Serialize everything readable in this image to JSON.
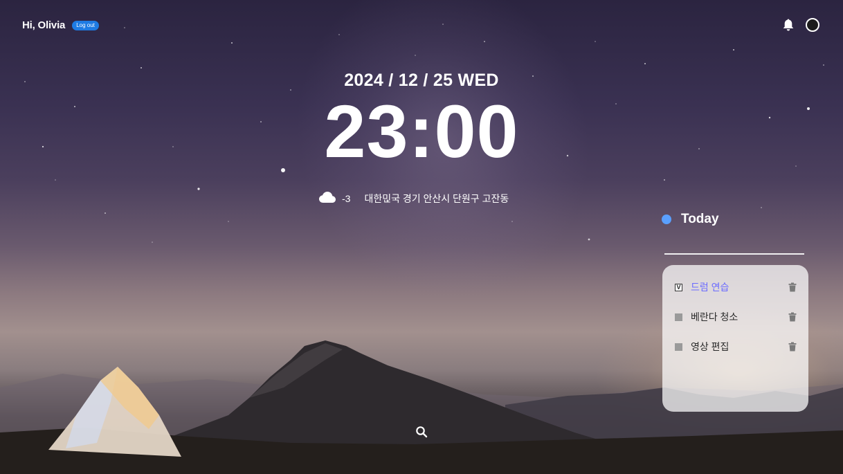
{
  "header": {
    "greeting": "Hi, Olivia",
    "logout_label": "Log out",
    "icons": [
      "bell-icon",
      "profile-icon"
    ]
  },
  "clock": {
    "date": "2024 / 12 / 25 WED",
    "time": "23:00"
  },
  "weather": {
    "icon": "cloud-icon",
    "temperature": "-3",
    "location": "대한민국 경기 안산시 단원구 고잔동"
  },
  "today": {
    "title": "Today",
    "dot_color": "#5aa0ff",
    "input_value": "",
    "items": [
      {
        "label": "드럼 연습",
        "checked": true,
        "check_mark": "V"
      },
      {
        "label": "베란다 청소",
        "checked": false,
        "check_mark": ""
      },
      {
        "label": "영상 편집",
        "checked": false,
        "check_mark": ""
      }
    ]
  },
  "footer": {
    "search_icon": "search-icon"
  },
  "colors": {
    "accent": "#1e7be3",
    "done_text": "#6b6bff"
  }
}
